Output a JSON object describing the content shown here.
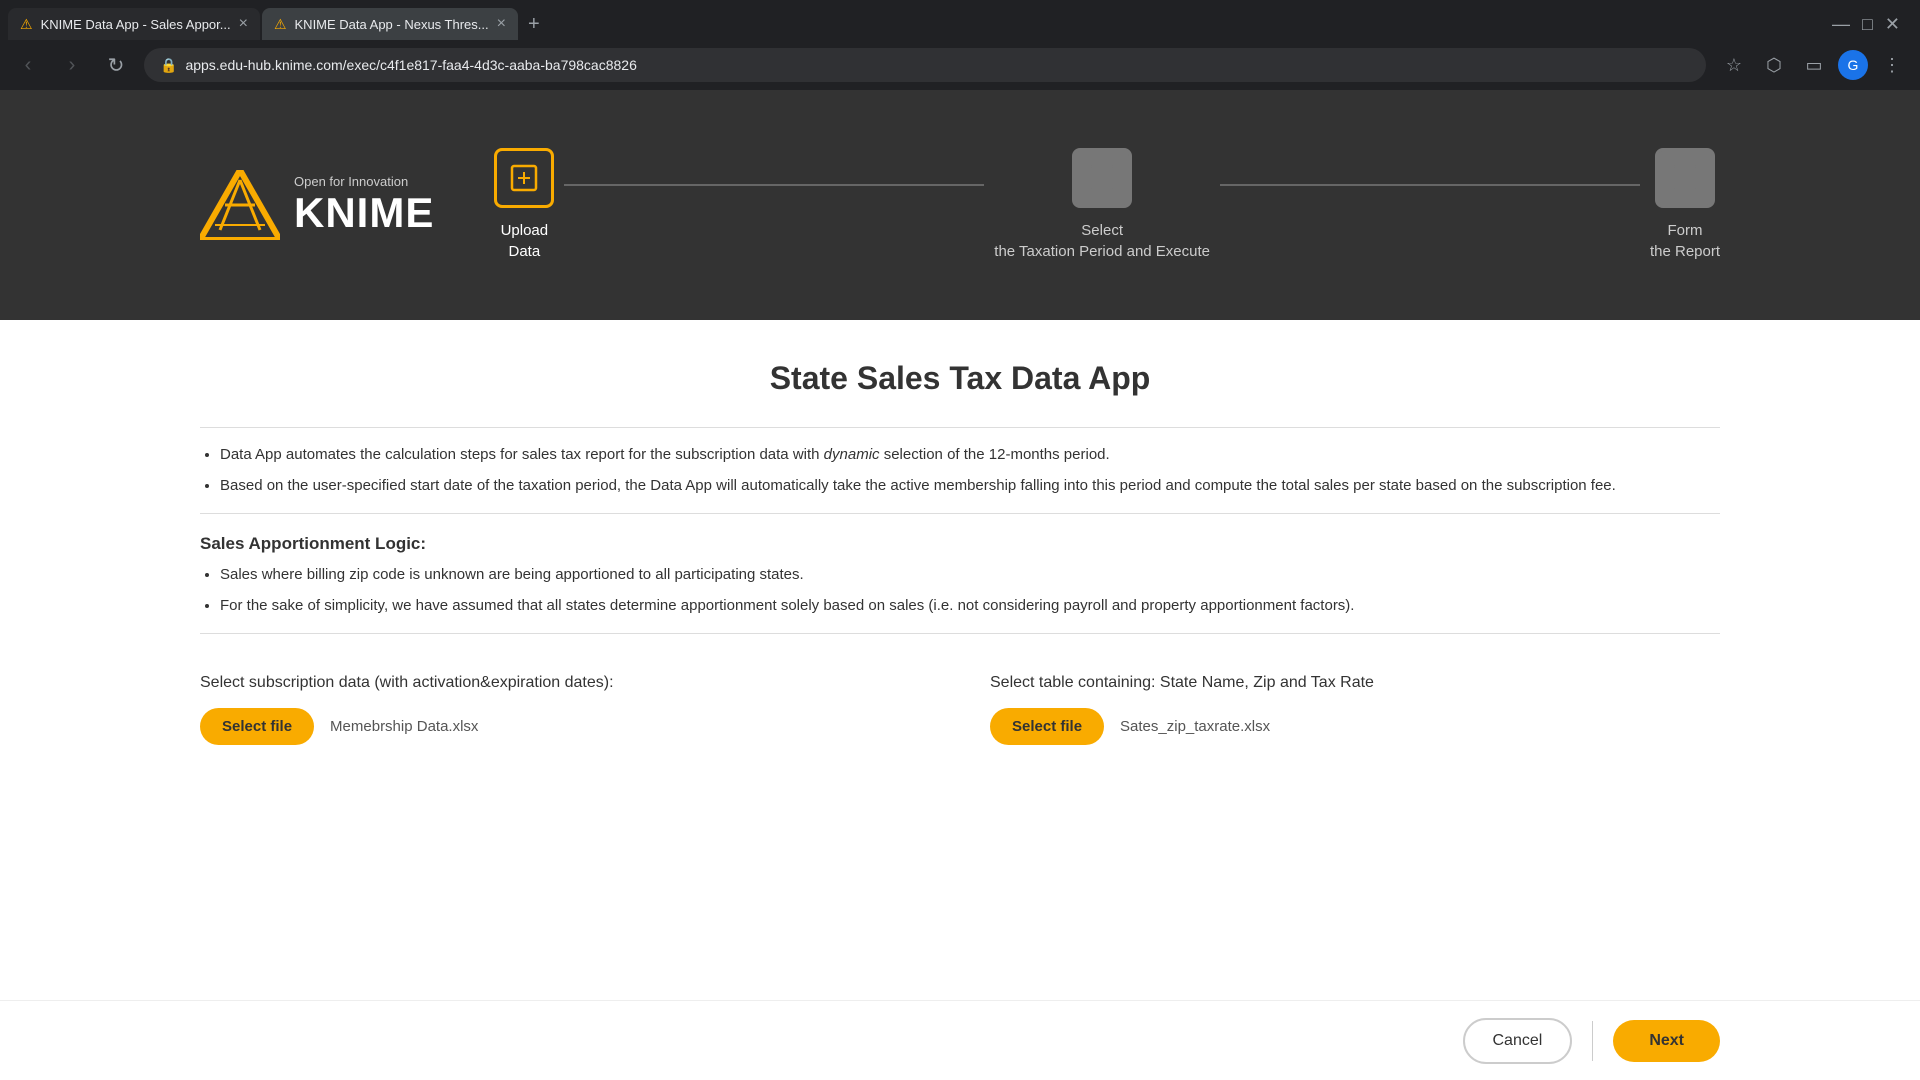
{
  "browser": {
    "tabs": [
      {
        "id": "tab1",
        "label": "KNIME Data App - Sales Appor...",
        "active": true
      },
      {
        "id": "tab2",
        "label": "KNIME Data App - Nexus Thres...",
        "active": false
      }
    ],
    "url": "apps.edu-hub.knime.com/exec/c4f1e817-faa4-4d3c-aaba-ba798cac8826"
  },
  "header": {
    "logo_tagline": "Open for Innovation",
    "logo_name": "KNIME"
  },
  "stepper": {
    "steps": [
      {
        "id": "step1",
        "label": "Upload\nData",
        "active": true
      },
      {
        "id": "step2",
        "label": "Select\nthe Taxation Period and Execute",
        "active": false
      },
      {
        "id": "step3",
        "label": "Form\nthe Report",
        "active": false
      }
    ]
  },
  "page": {
    "title": "State Sales Tax Data App",
    "bullets1": [
      "Data App automates the calculation steps for sales tax report for the subscription data with dynamic selection of the 12-months period.",
      "Based on the user-specified start date of the taxation period, the Data App will automatically take the active membership falling into this period and compute the total sales per state based on the subscription fee."
    ],
    "section_title": "Sales Apportionment Logic:",
    "bullets2": [
      "Sales where billing zip code is unknown are being apportioned to all participating states.",
      "For the sake of simplicity, we have assumed that all states determine apportionment solely based on sales (i.e. not considering payroll and property apportionment factors)."
    ]
  },
  "file_sections": {
    "section1": {
      "label": "Select subscription data (with activation&expiration dates):",
      "button_label": "Select file",
      "file_name": "Memebrship Data.xlsx"
    },
    "section2": {
      "label": "Select table containing: State Name, Zip and Tax Rate",
      "button_label": "Select file",
      "file_name": "Sates_zip_taxrate.xlsx"
    }
  },
  "footer": {
    "cancel_label": "Cancel",
    "next_label": "Next"
  }
}
